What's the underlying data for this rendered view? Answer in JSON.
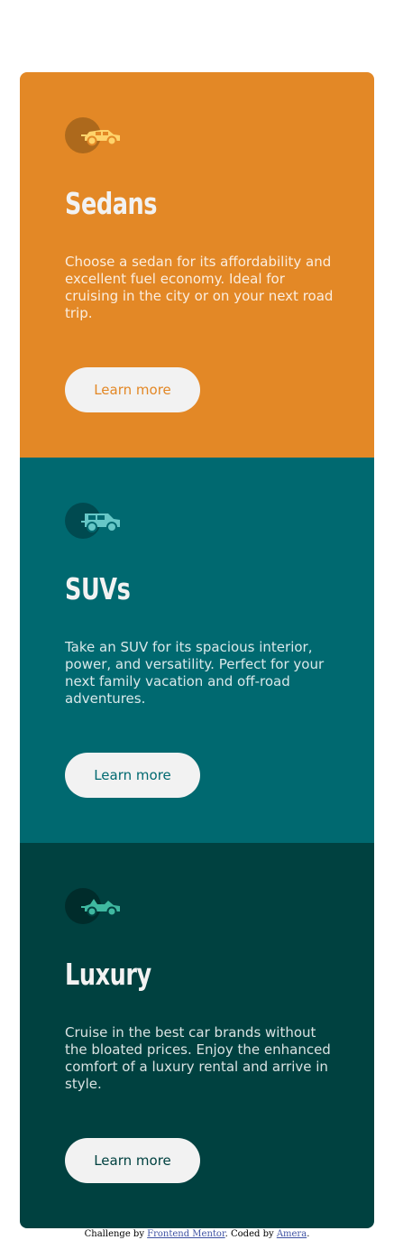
{
  "cards": [
    {
      "id": "sedans",
      "title": "Sedans",
      "text": "Choose a sedan for its affordability and excellent fuel economy. Ideal for cruising in the city or on your next road trip.",
      "button": "Learn more",
      "icon": "sedan-car-icon",
      "color": "#e38826"
    },
    {
      "id": "suvs",
      "title": "SUVs",
      "text": "Take an SUV for its spacious interior, power, and versatility. Perfect for your next family vacation and off-road adventures.",
      "button": "Learn more",
      "icon": "suv-car-icon",
      "color": "#006970"
    },
    {
      "id": "luxury",
      "title": "Luxury",
      "text": "Cruise in the best car brands without the bloated prices. Enjoy the enhanced comfort of a luxury rental and arrive in style.",
      "button": "Learn more",
      "icon": "luxury-car-icon",
      "color": "#004140"
    }
  ],
  "attribution": {
    "prefix": "Challenge by ",
    "link1": "Frontend Mentor",
    "middle": ". Coded by ",
    "link2": "Amera",
    "suffix": "."
  }
}
